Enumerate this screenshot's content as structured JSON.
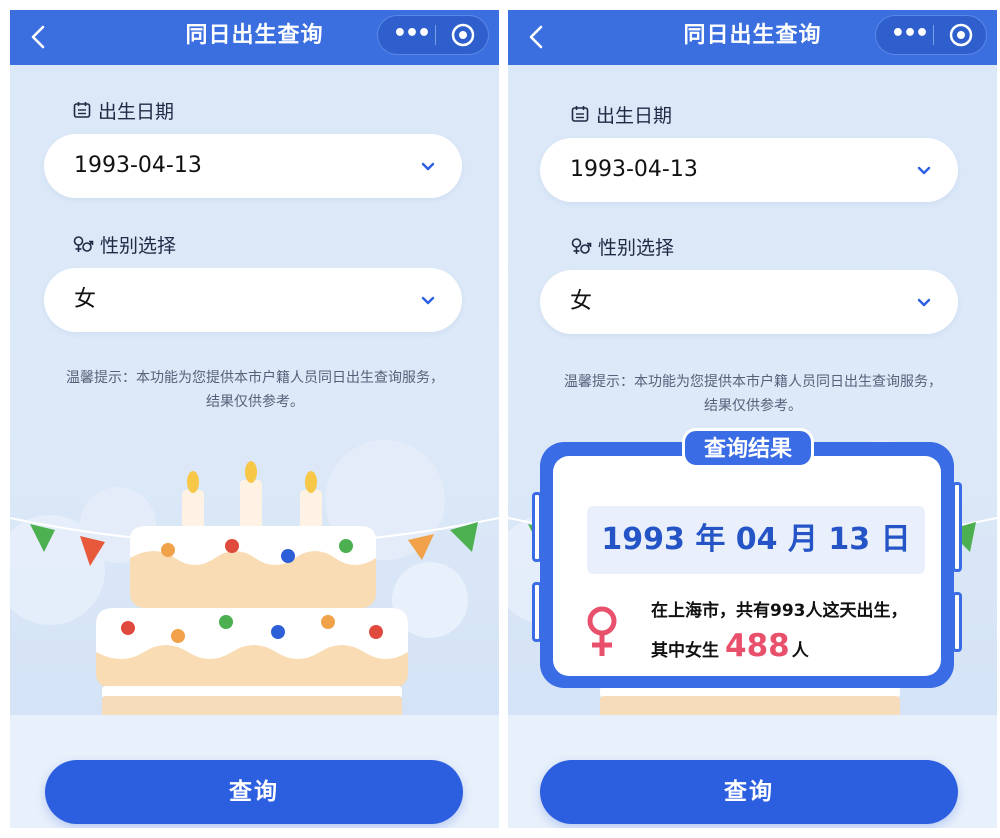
{
  "navbar": {
    "title": "同日出生查询",
    "more_glyph": "•••",
    "back_glyph": "‹"
  },
  "form": {
    "birth_date_label": "出生日期",
    "birth_date_value": "1993-04-13",
    "gender_label": "性别选择",
    "gender_value": "女"
  },
  "tip": {
    "text": "温馨提示：本功能为您提供本市户籍人员同日出生查询服务，结果仅供参考。"
  },
  "query_button_label": "查询",
  "result": {
    "tag": "查询结果",
    "date_text": "1993 年 04 月 13 日",
    "line1": "在上海市，共有993人这天出生，",
    "line2_prefix": "其中女生",
    "count": "488",
    "line2_suffix": "人"
  },
  "colors": {
    "primary": "#3b6fe0",
    "button": "#2c5fe0",
    "accent_red": "#e8506c",
    "background": "#dde9f8"
  },
  "icons": [
    "back-icon",
    "more-icon",
    "close-capsule-icon",
    "calendar-icon",
    "gender-icon",
    "chevron-down-icon",
    "female-icon"
  ]
}
